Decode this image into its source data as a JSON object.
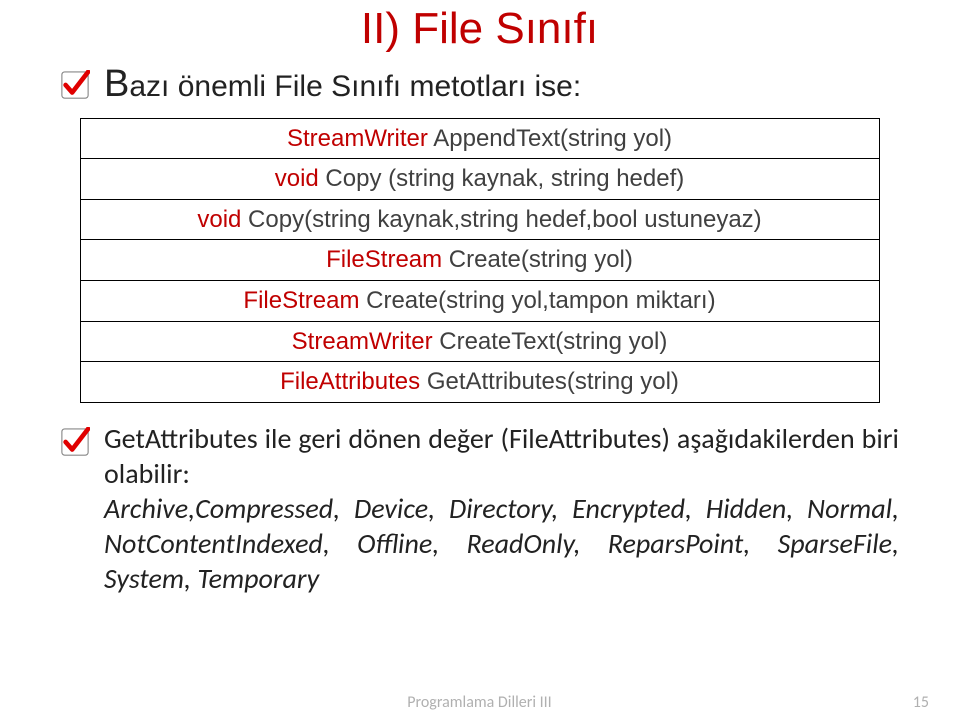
{
  "title": "II) File Sınıfı",
  "bullet1": {
    "lead": "B",
    "rest": "azı önemli File Sınıfı metotları ise:"
  },
  "table_rows": [
    {
      "ret": "StreamWriter",
      "sig": " AppendText(string yol)"
    },
    {
      "ret": "void",
      "sig": " Copy (string kaynak, string hedef)"
    },
    {
      "ret": "void",
      "sig": " Copy(string kaynak,string hedef,bool ustuneyaz)"
    },
    {
      "ret": "FileStream",
      "sig": " Create(string yol)"
    },
    {
      "ret": "FileStream",
      "sig": " Create(string yol,tampon miktarı)"
    },
    {
      "ret": "StreamWriter",
      "sig": " CreateText(string yol)"
    },
    {
      "ret": "FileAttributes",
      "sig": " GetAttributes(string yol)"
    }
  ],
  "bullet2": {
    "line1": "GetAttributes ile geri dönen değer (FileAttributes) aşağıdakilerden biri olabilir:",
    "line2": "Archive,Compressed, Device, Directory, Encrypted, Hidden, Normal, NotContentIndexed, Offline, ReadOnly, ReparsPoint, SparseFile, System, Temporary"
  },
  "footer": {
    "course": "Programlama Dilleri III",
    "page": "15"
  }
}
